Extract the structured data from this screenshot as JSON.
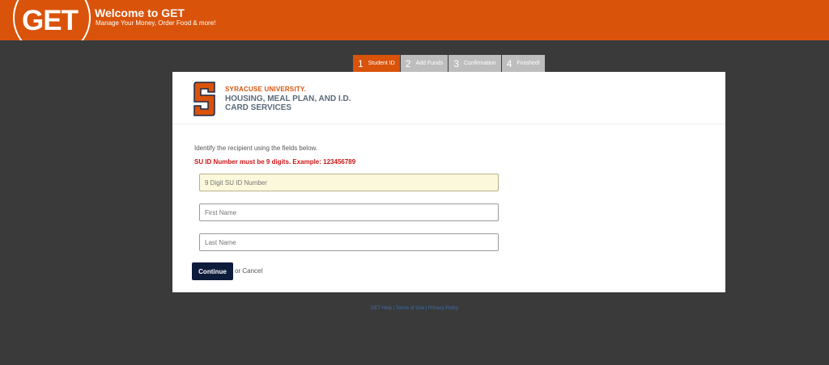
{
  "header": {
    "logo_text": "GET",
    "title": "Welcome to GET",
    "subtitle": "Manage Your Money, Order Food & more!"
  },
  "steps": [
    {
      "num": "1",
      "label": "Student ID"
    },
    {
      "num": "2",
      "label": "Add Funds"
    },
    {
      "num": "3",
      "label": "Confirmation"
    },
    {
      "num": "4",
      "label": "Finished!"
    }
  ],
  "brand": {
    "university": "SYRACUSE UNIVERSITY.",
    "department": "HOUSING, MEAL PLAN, AND I.D. CARD SERVICES"
  },
  "form": {
    "instructions": "Identify the recipient using the fields below.",
    "error": "SU ID Number must be 9 digits.  Example:   123456789",
    "id_placeholder": "9 Digit SU ID Number",
    "first_placeholder": "First Name",
    "last_placeholder": "Last Name",
    "continue_label": "Continue",
    "or_text": "or",
    "cancel_label": "Cancel"
  },
  "footer": {
    "links": [
      "GET Help",
      "Terms of Use",
      "Privacy Policy"
    ],
    "separator": "|"
  },
  "colors": {
    "accent": "#d9530a",
    "background": "#3a3a3a",
    "button": "#0e1c3c",
    "error": "#cc1414",
    "link": "#3b6fae"
  }
}
